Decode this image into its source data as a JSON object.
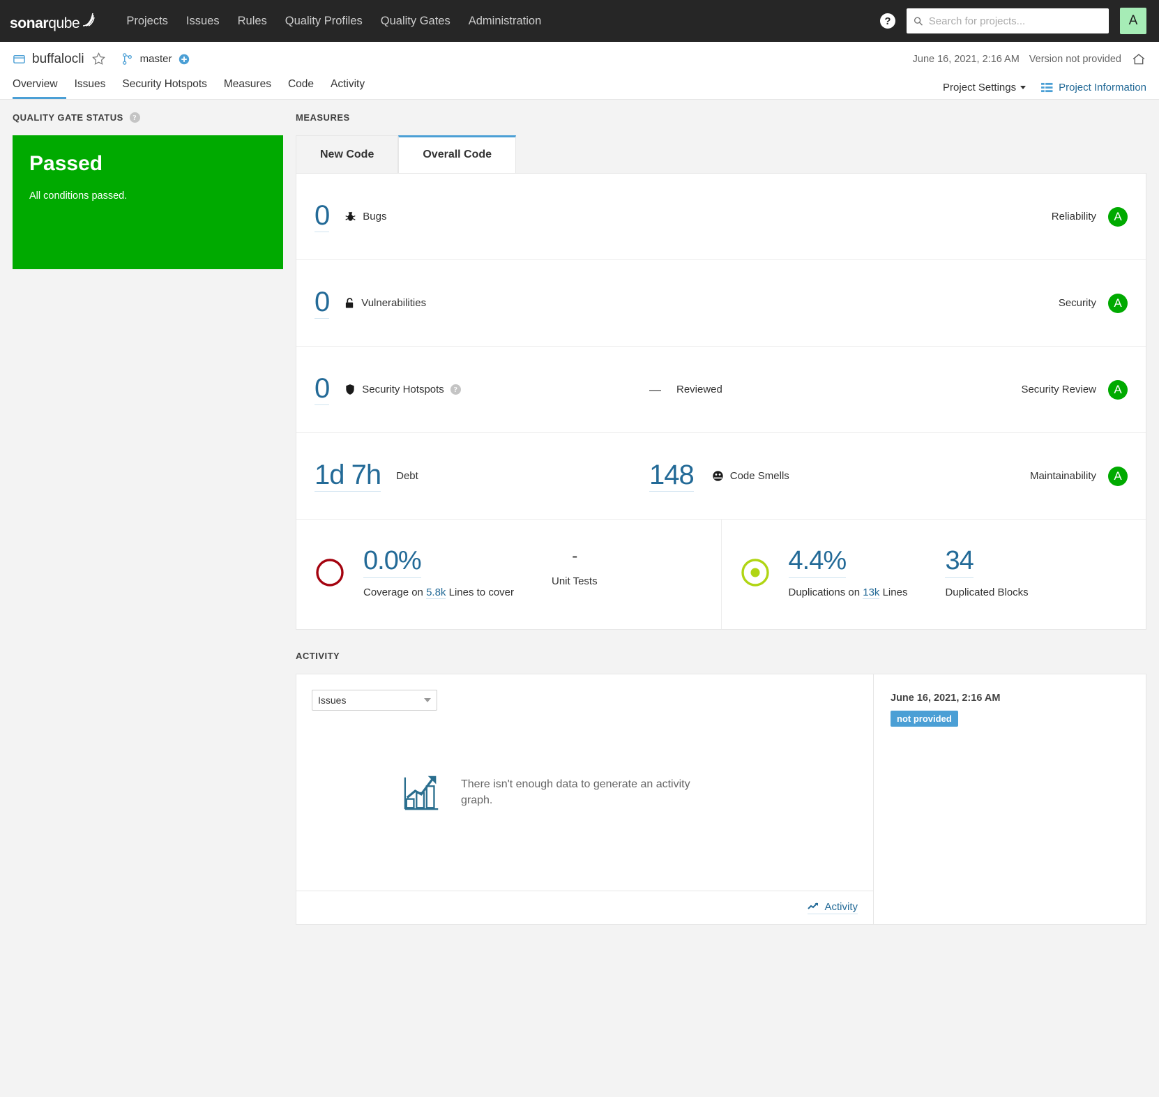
{
  "global_nav": {
    "logo": {
      "bold": "sonar",
      "light": "qube"
    },
    "links": [
      {
        "label": "Projects"
      },
      {
        "label": "Issues"
      },
      {
        "label": "Rules"
      },
      {
        "label": "Quality Profiles"
      },
      {
        "label": "Quality Gates"
      },
      {
        "label": "Administration"
      }
    ],
    "help_label": "?",
    "search": {
      "placeholder": "Search for projects...",
      "value": ""
    },
    "avatar_initial": "A",
    "avatar_color": "#a6ecb6",
    "background": "#262626"
  },
  "project_header": {
    "name": "buffalocli",
    "branch": "master",
    "analysis_date": "June 16, 2021, 2:16 AM",
    "version": "Version not provided",
    "tabs": [
      {
        "label": "Overview",
        "active": true
      },
      {
        "label": "Issues",
        "active": false
      },
      {
        "label": "Security Hotspots",
        "active": false
      },
      {
        "label": "Measures",
        "active": false
      },
      {
        "label": "Code",
        "active": false
      },
      {
        "label": "Activity",
        "active": false
      }
    ],
    "settings_label": "Project Settings",
    "information_label": "Project Information"
  },
  "quality_gate": {
    "section_title": "Quality Gate Status",
    "status": "Passed",
    "description": "All conditions passed.",
    "color": "#00aa00"
  },
  "measures": {
    "section_title": "Measures",
    "tabs": [
      {
        "label": "New Code",
        "active": false
      },
      {
        "label": "Overall Code",
        "active": true
      }
    ],
    "rows": [
      {
        "value": "0",
        "label": "Bugs",
        "icon": "bug-icon",
        "rating_name": "Reliability",
        "rating": "A",
        "rating_color": "#00aa00"
      },
      {
        "value": "0",
        "label": "Vulnerabilities",
        "icon": "vulnerability-icon",
        "rating_name": "Security",
        "rating": "A",
        "rating_color": "#00aa00"
      },
      {
        "value": "0",
        "label": "Security Hotspots",
        "icon": "security-hotspot-icon",
        "mid_value": "—",
        "mid_label": "Reviewed",
        "rating_name": "Security Review",
        "rating": "A",
        "rating_color": "#00aa00"
      }
    ],
    "debt_row": {
      "value": "1d 7h",
      "label": "Debt",
      "smells_value": "148",
      "smells_label": "Code Smells",
      "rating_name": "Maintainability",
      "rating": "A",
      "rating_color": "#00aa00"
    },
    "coverage": {
      "percent": "0.0%",
      "caption_prefix": "Coverage on",
      "caption_lines": "5.8k",
      "caption_suffix": "Lines to cover",
      "unit_tests_value": "-",
      "unit_tests_label": "Unit Tests",
      "ring_color": "#a4030f"
    },
    "duplications": {
      "percent": "4.4%",
      "caption_prefix": "Duplications on",
      "caption_lines": "13k",
      "caption_suffix": "Lines",
      "blocks_value": "34",
      "blocks_label": "Duplicated Blocks",
      "ring_color": "#b0d513"
    }
  },
  "activity": {
    "section_title": "Activity",
    "graph_select_value": "Issues",
    "empty_message": "There isn't enough data to generate an activity graph.",
    "footer_link": "Activity",
    "event_date": "June 16, 2021, 2:16 AM",
    "event_badge": "not provided",
    "event_badge_color": "#4b9fd5"
  }
}
